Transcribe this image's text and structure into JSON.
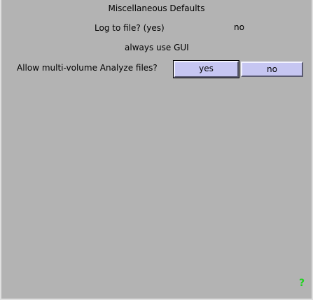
{
  "dialog": {
    "title": "Miscellaneous Defaults",
    "log_to_file": {
      "label": "Log to file? (yes)",
      "value": "no"
    },
    "always_use_gui": {
      "label": "always use GUI"
    },
    "multi_volume": {
      "label": "Allow multi-volume Analyze files?",
      "yes_label": "yes",
      "no_label": "no",
      "selected": "yes"
    },
    "help": {
      "symbol": "?",
      "color": "#1fd31f",
      "icon": "help-icon"
    }
  },
  "colors": {
    "background": "#b3b3b3",
    "button": "#c6c6f2"
  }
}
